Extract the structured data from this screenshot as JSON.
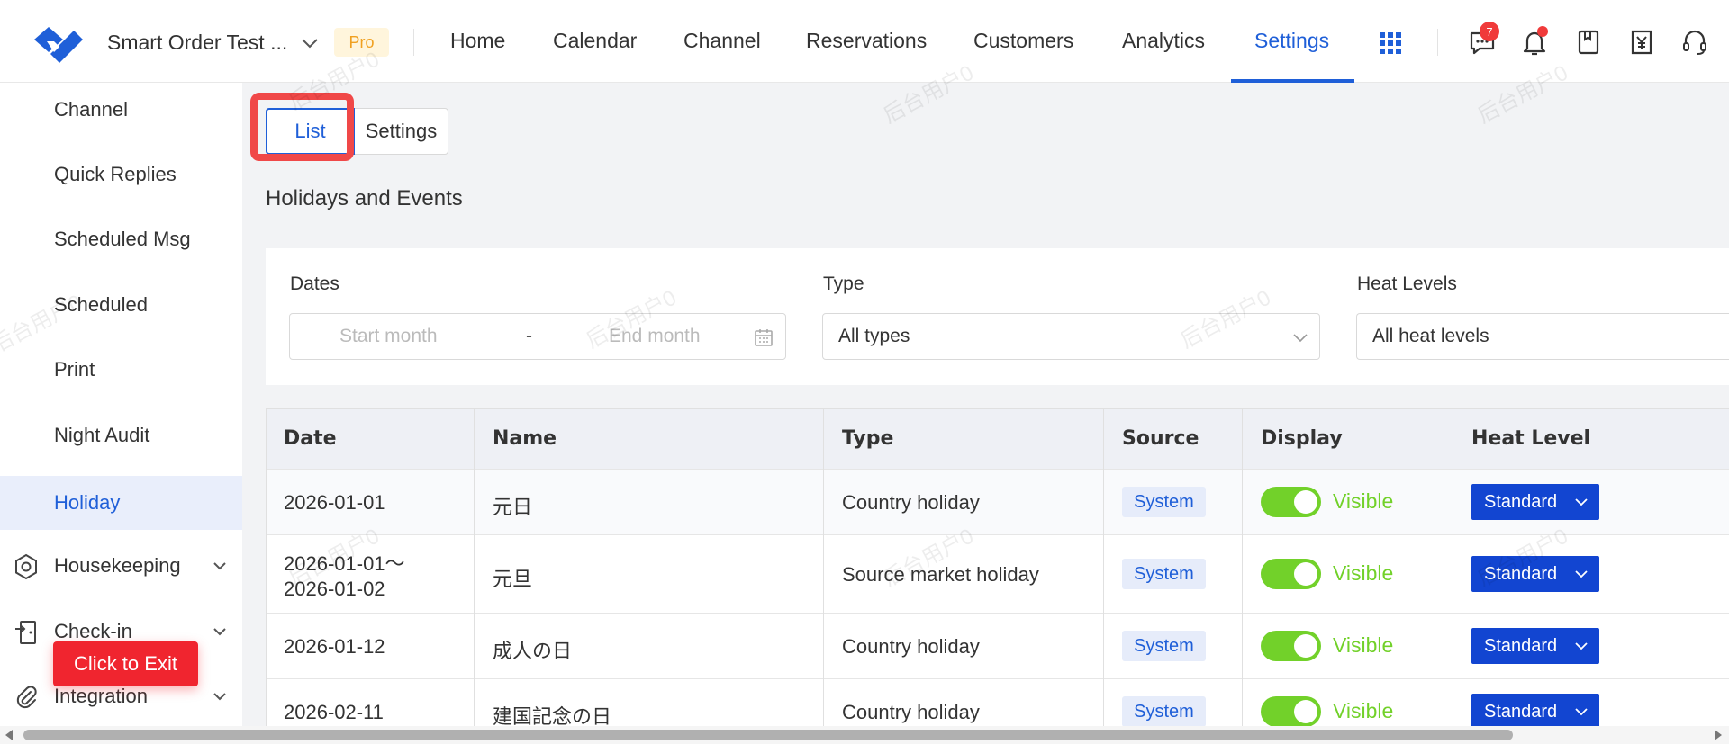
{
  "header": {
    "store_name": "Smart Order Test ...",
    "plan_badge": "Pro",
    "nav": [
      "Home",
      "Calendar",
      "Channel",
      "Reservations",
      "Customers",
      "Analytics",
      "Settings"
    ],
    "active_nav": "Settings",
    "message_count": "7"
  },
  "sidebar": {
    "items": [
      "Channel",
      "Quick Replies",
      "Scheduled Msg",
      "Scheduled",
      "Print",
      "Night Audit",
      "Holiday"
    ],
    "active": "Holiday",
    "groups": [
      "Housekeeping",
      "Check-in",
      "Integration"
    ],
    "exit_button": "Click to Exit"
  },
  "tabs": {
    "list": "List",
    "settings": "Settings"
  },
  "page_title": "Holidays and Events",
  "filters": {
    "dates_label": "Dates",
    "start_placeholder": "Start month",
    "separator": "-",
    "end_placeholder": "End month",
    "type_label": "Type",
    "type_value": "All types",
    "heat_label": "Heat Levels",
    "heat_value": "All heat levels"
  },
  "table": {
    "columns": [
      "Date",
      "Name",
      "Type",
      "Source",
      "Display",
      "Heat Level"
    ],
    "rows": [
      {
        "date": "2026-01-01",
        "date2": "",
        "name": "元日",
        "type": "Country holiday",
        "source": "System",
        "display": "Visible",
        "heat": "Standard"
      },
      {
        "date": "2026-01-01～",
        "date2": "2026-01-02",
        "name": "元旦",
        "type": "Source market holiday",
        "source": "System",
        "display": "Visible",
        "heat": "Standard"
      },
      {
        "date": "2026-01-12",
        "date2": "",
        "name": "成人の日",
        "type": "Country holiday",
        "source": "System",
        "display": "Visible",
        "heat": "Standard"
      },
      {
        "date": "2026-02-11",
        "date2": "",
        "name": "建国記念の日",
        "type": "Country holiday",
        "source": "System",
        "display": "Visible",
        "heat": "Standard"
      }
    ]
  },
  "watermark": "后台用户0",
  "colors": {
    "accent": "#1f5fd8",
    "toggle_on": "#72d12a",
    "danger": "#f0252f",
    "heat_button": "#1245d1"
  }
}
